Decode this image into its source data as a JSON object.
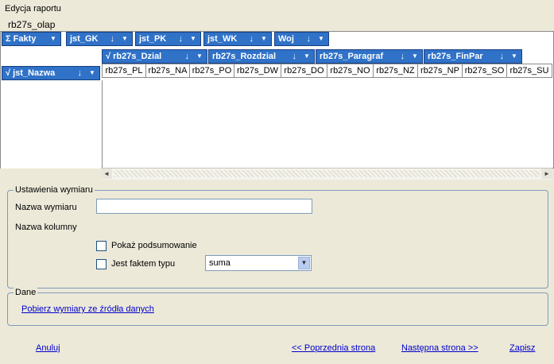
{
  "window": {
    "title": "Edycja raportu"
  },
  "source_name": "rb27s_olap",
  "filter_bar": [
    {
      "label": "Σ Fakty",
      "arrow": "",
      "drop": "▼"
    },
    {
      "label": "jst_GK",
      "arrow": "↓",
      "drop": "▼"
    },
    {
      "label": "jst_PK",
      "arrow": "↓",
      "drop": "▼"
    },
    {
      "label": "jst_WK",
      "arrow": "↓",
      "drop": "▼"
    },
    {
      "label": "Woj",
      "arrow": "↓",
      "drop": "▼"
    }
  ],
  "column_dims": [
    {
      "label": "√ rb27s_Dzial",
      "arrow": "↓",
      "drop": "▼"
    },
    {
      "label": "rb27s_Rozdzial",
      "arrow": "↓",
      "drop": "▼"
    },
    {
      "label": "rb27s_Paragraf",
      "arrow": "↓",
      "drop": "▼"
    },
    {
      "label": "rb27s_FinPar",
      "arrow": "↓",
      "drop": "▼"
    }
  ],
  "row_dim": {
    "label": "√ jst_Nazwa",
    "arrow": "↓",
    "drop": "▼"
  },
  "columns": [
    "rb27s_PL",
    "rb27s_NA",
    "rb27s_PO",
    "rb27s_DW",
    "rb27s_DO",
    "rb27s_NO",
    "rb27s_NZ",
    "rb27s_NP",
    "rb27s_SO",
    "rb27s_SU"
  ],
  "scroll": {
    "left": "◄",
    "right": "►"
  },
  "settings": {
    "legend": "Ustawienia wymiaru",
    "dim_name_label": "Nazwa wymiaru",
    "dim_name_value": "",
    "col_name_label": "Nazwa kolumny",
    "show_summary_label": "Pokaż podsumowanie",
    "is_fact_label": "Jest faktem typu",
    "fact_type_value": "suma",
    "dropdown_icon": "▼"
  },
  "data_group": {
    "legend": "Dane",
    "fetch_link": "Pobierz wymiary ze źródła danych"
  },
  "footer": {
    "cancel": "Anuluj",
    "prev": "<< Poprzednia strona",
    "next": "Następna strona >>",
    "save": "Zapisz"
  }
}
